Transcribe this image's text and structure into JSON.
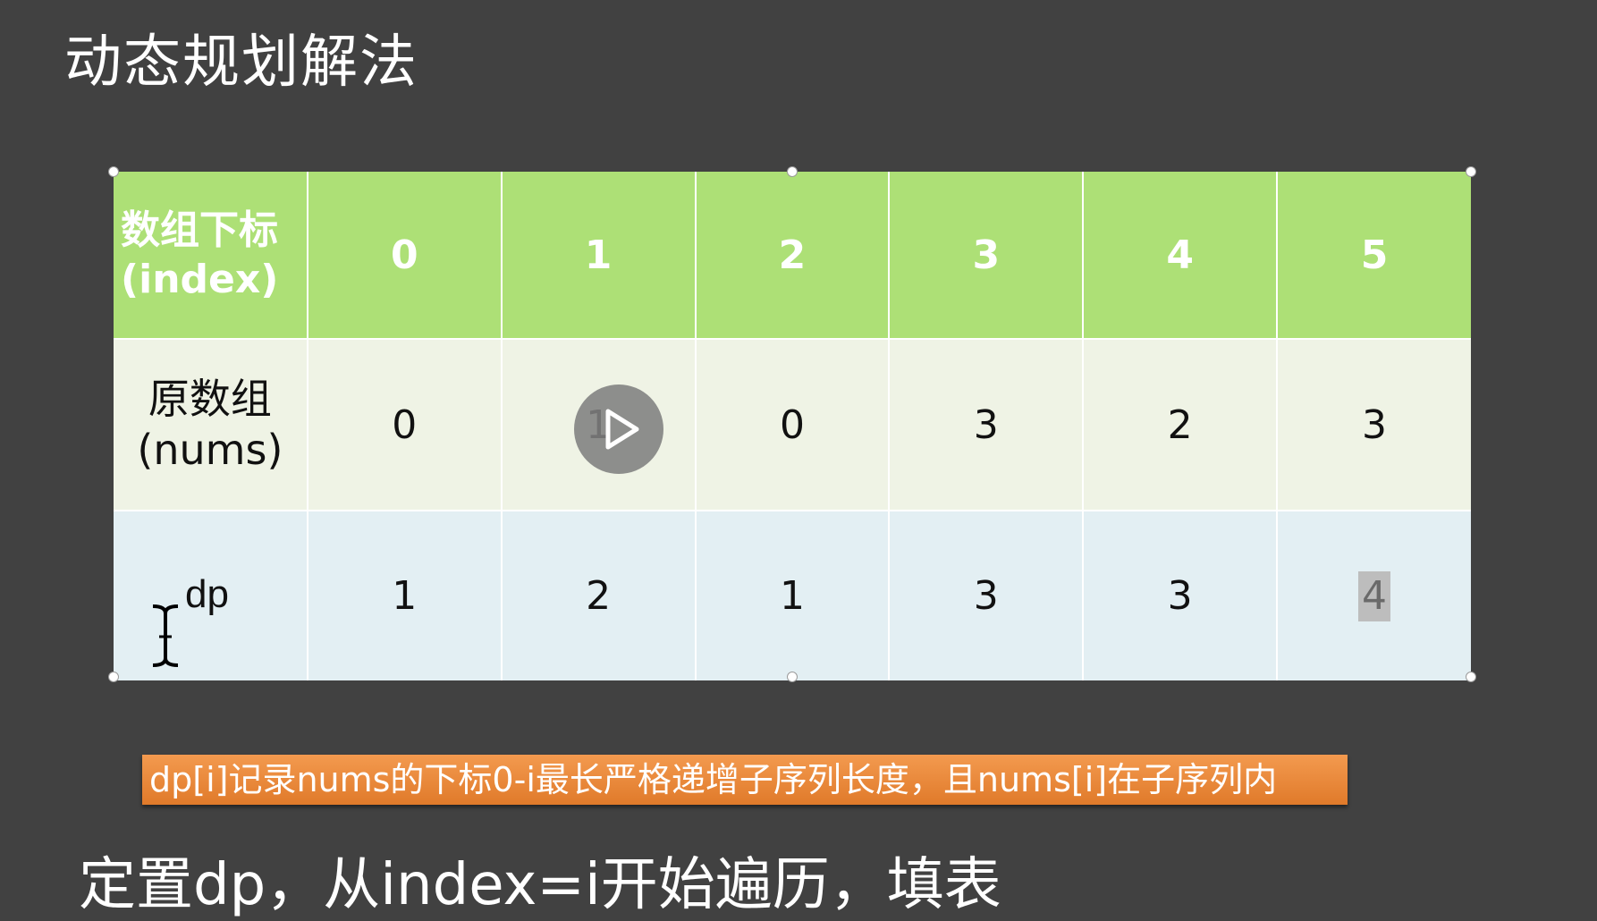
{
  "slide": {
    "title": "动态规划解法",
    "caption": "dp[i]记录nums的下标0-i最长严格递增子序列长度，且nums[i]在子序列内",
    "bottom_text": "定置dp，从index=i开始遍历，填表"
  },
  "table": {
    "index_header": [
      "数组下标",
      "(index)"
    ],
    "nums_header": [
      "原数组",
      "(nums)"
    ],
    "dp_header": "dp",
    "index": [
      "0",
      "1",
      "2",
      "3",
      "4",
      "5"
    ],
    "nums": [
      "0",
      "1",
      "0",
      "3",
      "2",
      "3"
    ],
    "dp": [
      "1",
      "2",
      "1",
      "3",
      "3",
      "4"
    ]
  },
  "colors": {
    "background": "#414141",
    "header_row": "#ade076",
    "nums_row": "#eff3e5",
    "dp_row": "#e3eff3",
    "caption_bg": "#ef8a3c"
  },
  "icons": [
    "play-icon",
    "text-cursor-icon",
    "selection-handle"
  ]
}
